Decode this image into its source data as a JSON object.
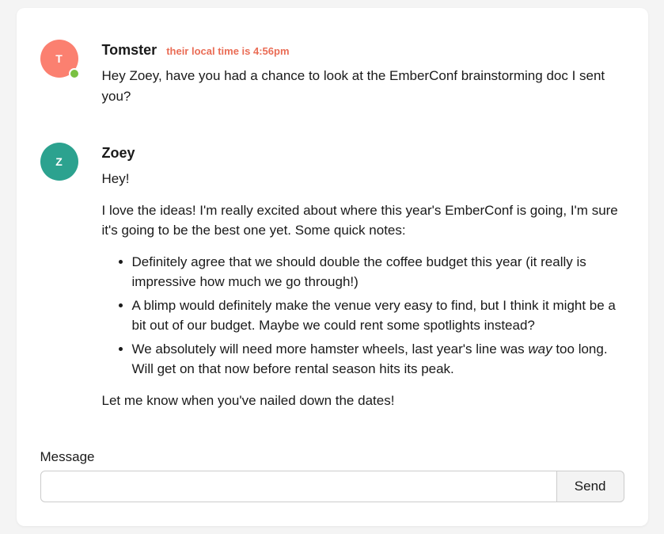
{
  "colors": {
    "tomster_avatar": "#fb8070",
    "zoey_avatar": "#2ca28f",
    "presence_active": "#7ac142",
    "local_time_text": "#ea6d56"
  },
  "messages": [
    {
      "id": "tomster",
      "initial": "T",
      "name": "Tomster",
      "active": true,
      "local_time": "their local time is 4:56pm",
      "paragraphs": [
        "Hey Zoey, have you had a chance to look at the EmberConf brainstorming doc I sent you?"
      ]
    },
    {
      "id": "zoey",
      "initial": "Z",
      "name": "Zoey",
      "active": false,
      "local_time": "",
      "paragraphs": [
        "Hey!",
        "I love the ideas! I'm really excited about where this year's EmberConf is going, I'm sure it's going to be the best one yet. Some quick notes:"
      ],
      "bullets": [
        "Definitely agree that we should double the coffee budget this year (it really is impressive how much we go through!)",
        "A blimp would definitely make the venue very easy to find, but I think it might be a bit out of our budget. Maybe we could rent some spotlights instead?",
        {
          "pre": "We absolutely will need more hamster wheels, last year's line was ",
          "em": "way",
          "post": " too long. Will get on that now before rental season hits its peak."
        }
      ],
      "closing": "Let me know when you've nailed down the dates!"
    }
  ],
  "form": {
    "label": "Message",
    "value": "",
    "send_label": "Send"
  }
}
